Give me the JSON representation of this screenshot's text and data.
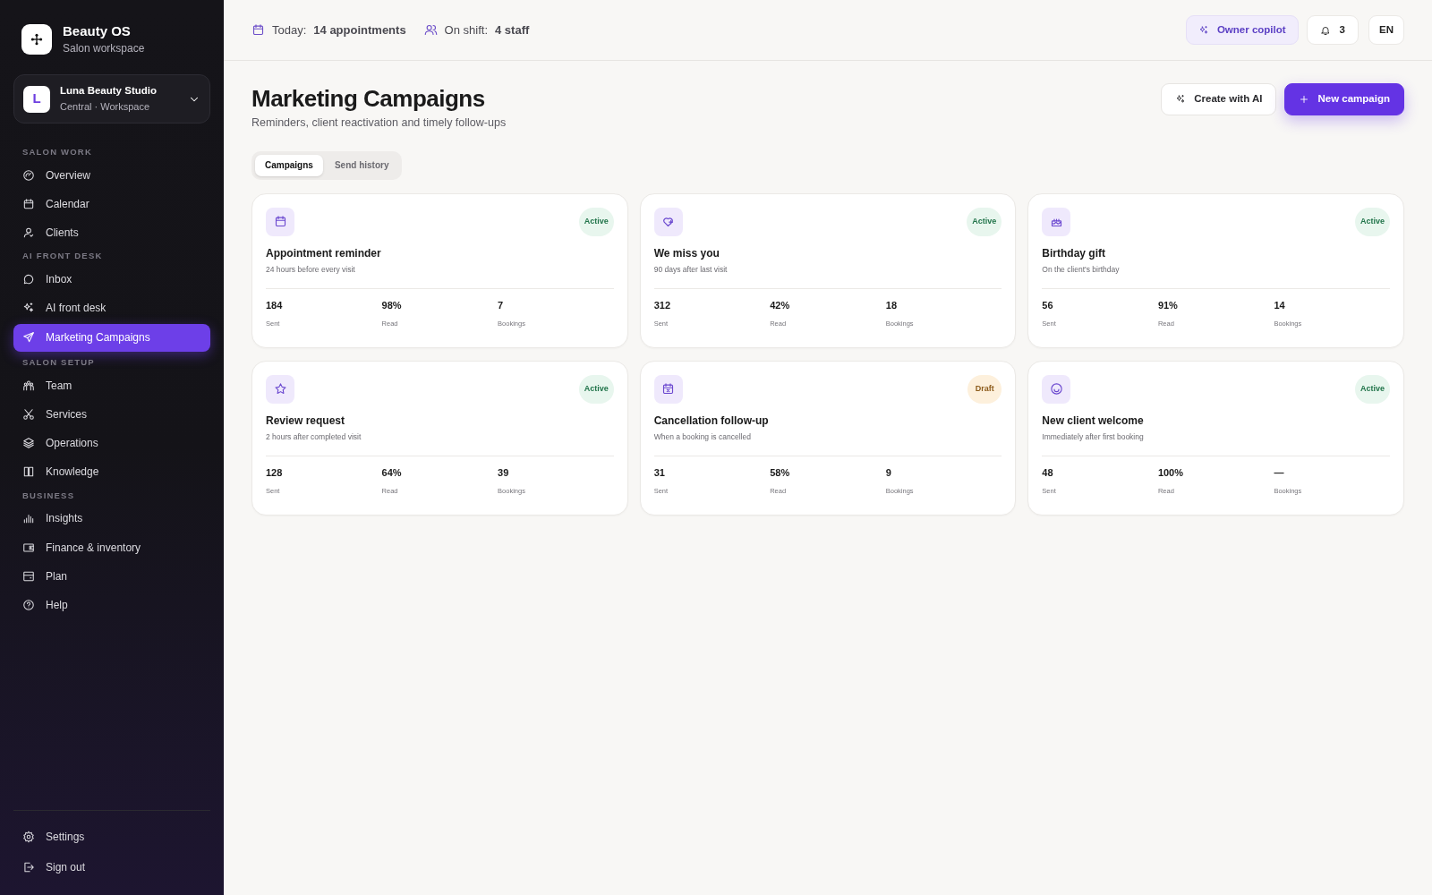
{
  "brand": {
    "name": "Beauty OS",
    "subtitle": "Salon workspace"
  },
  "workspace": {
    "initial": "L",
    "name": "Luna Beauty Studio",
    "subtitle": "Central · Workspace"
  },
  "sidebar": {
    "sections": [
      {
        "heading": "SALON WORK",
        "items": [
          {
            "label": "Overview",
            "selected": false
          },
          {
            "label": "Calendar",
            "selected": false
          },
          {
            "label": "Clients",
            "selected": false
          }
        ]
      },
      {
        "heading": "AI FRONT DESK",
        "items": [
          {
            "label": "Inbox",
            "selected": false
          },
          {
            "label": "AI front desk",
            "selected": false
          },
          {
            "label": "Marketing Campaigns",
            "selected": true
          }
        ]
      },
      {
        "heading": "SALON SETUP",
        "items": [
          {
            "label": "Team",
            "selected": false
          },
          {
            "label": "Services",
            "selected": false
          },
          {
            "label": "Operations",
            "selected": false
          },
          {
            "label": "Knowledge",
            "selected": false
          }
        ]
      },
      {
        "heading": "BUSINESS",
        "items": [
          {
            "label": "Insights",
            "selected": false
          },
          {
            "label": "Finance & inventory",
            "selected": false
          },
          {
            "label": "Plan",
            "selected": false
          },
          {
            "label": "Help",
            "selected": false
          }
        ]
      }
    ],
    "footer": [
      {
        "label": "Settings"
      },
      {
        "label": "Sign out"
      }
    ]
  },
  "top_bar": {
    "stats": [
      {
        "label": "Today:",
        "value": "14 appointments"
      },
      {
        "label": "On shift:",
        "value": "4 staff"
      }
    ],
    "copilot": "Owner copilot",
    "notifications": "3",
    "language": "EN"
  },
  "page": {
    "title": "Marketing Campaigns",
    "subtitle": "Reminders, client reactivation and timely follow-ups",
    "buttons": [
      {
        "label": "Create with AI",
        "kind": "secondary"
      },
      {
        "label": "New campaign",
        "kind": "primary"
      }
    ]
  },
  "tabs": [
    {
      "label": "Campaigns",
      "selected": true
    },
    {
      "label": "Send history",
      "selected": false
    }
  ],
  "campaigns": [
    {
      "title": "Appointment reminder",
      "subtitle": "24 hours before every visit",
      "status": "Active",
      "kind": "active",
      "metrics": [
        {
          "value": "184",
          "label": "Sent"
        },
        {
          "value": "98%",
          "label": "Read"
        },
        {
          "value": "7",
          "label": "Bookings"
        }
      ]
    },
    {
      "title": "We miss you",
      "subtitle": "90 days after last visit",
      "status": "Active",
      "kind": "active",
      "metrics": [
        {
          "value": "312",
          "label": "Sent"
        },
        {
          "value": "42%",
          "label": "Read"
        },
        {
          "value": "18",
          "label": "Bookings"
        }
      ]
    },
    {
      "title": "Birthday gift",
      "subtitle": "On the client's birthday",
      "status": "Active",
      "kind": "active",
      "metrics": [
        {
          "value": "56",
          "label": "Sent"
        },
        {
          "value": "91%",
          "label": "Read"
        },
        {
          "value": "14",
          "label": "Bookings"
        }
      ]
    },
    {
      "title": "Review request",
      "subtitle": "2 hours after completed visit",
      "status": "Active",
      "kind": "active",
      "metrics": [
        {
          "value": "128",
          "label": "Sent"
        },
        {
          "value": "64%",
          "label": "Read"
        },
        {
          "value": "39",
          "label": "Bookings"
        }
      ]
    },
    {
      "title": "Cancellation follow-up",
      "subtitle": "When a booking is cancelled",
      "status": "Draft",
      "kind": "draft",
      "metrics": [
        {
          "value": "31",
          "label": "Sent"
        },
        {
          "value": "58%",
          "label": "Read"
        },
        {
          "value": "9",
          "label": "Bookings"
        }
      ]
    },
    {
      "title": "New client welcome",
      "subtitle": "Immediately after first booking",
      "status": "Active",
      "kind": "active",
      "metrics": [
        {
          "value": "48",
          "label": "Sent"
        },
        {
          "value": "100%",
          "label": "Read"
        },
        {
          "value": "—",
          "label": "Bookings"
        }
      ]
    }
  ]
}
